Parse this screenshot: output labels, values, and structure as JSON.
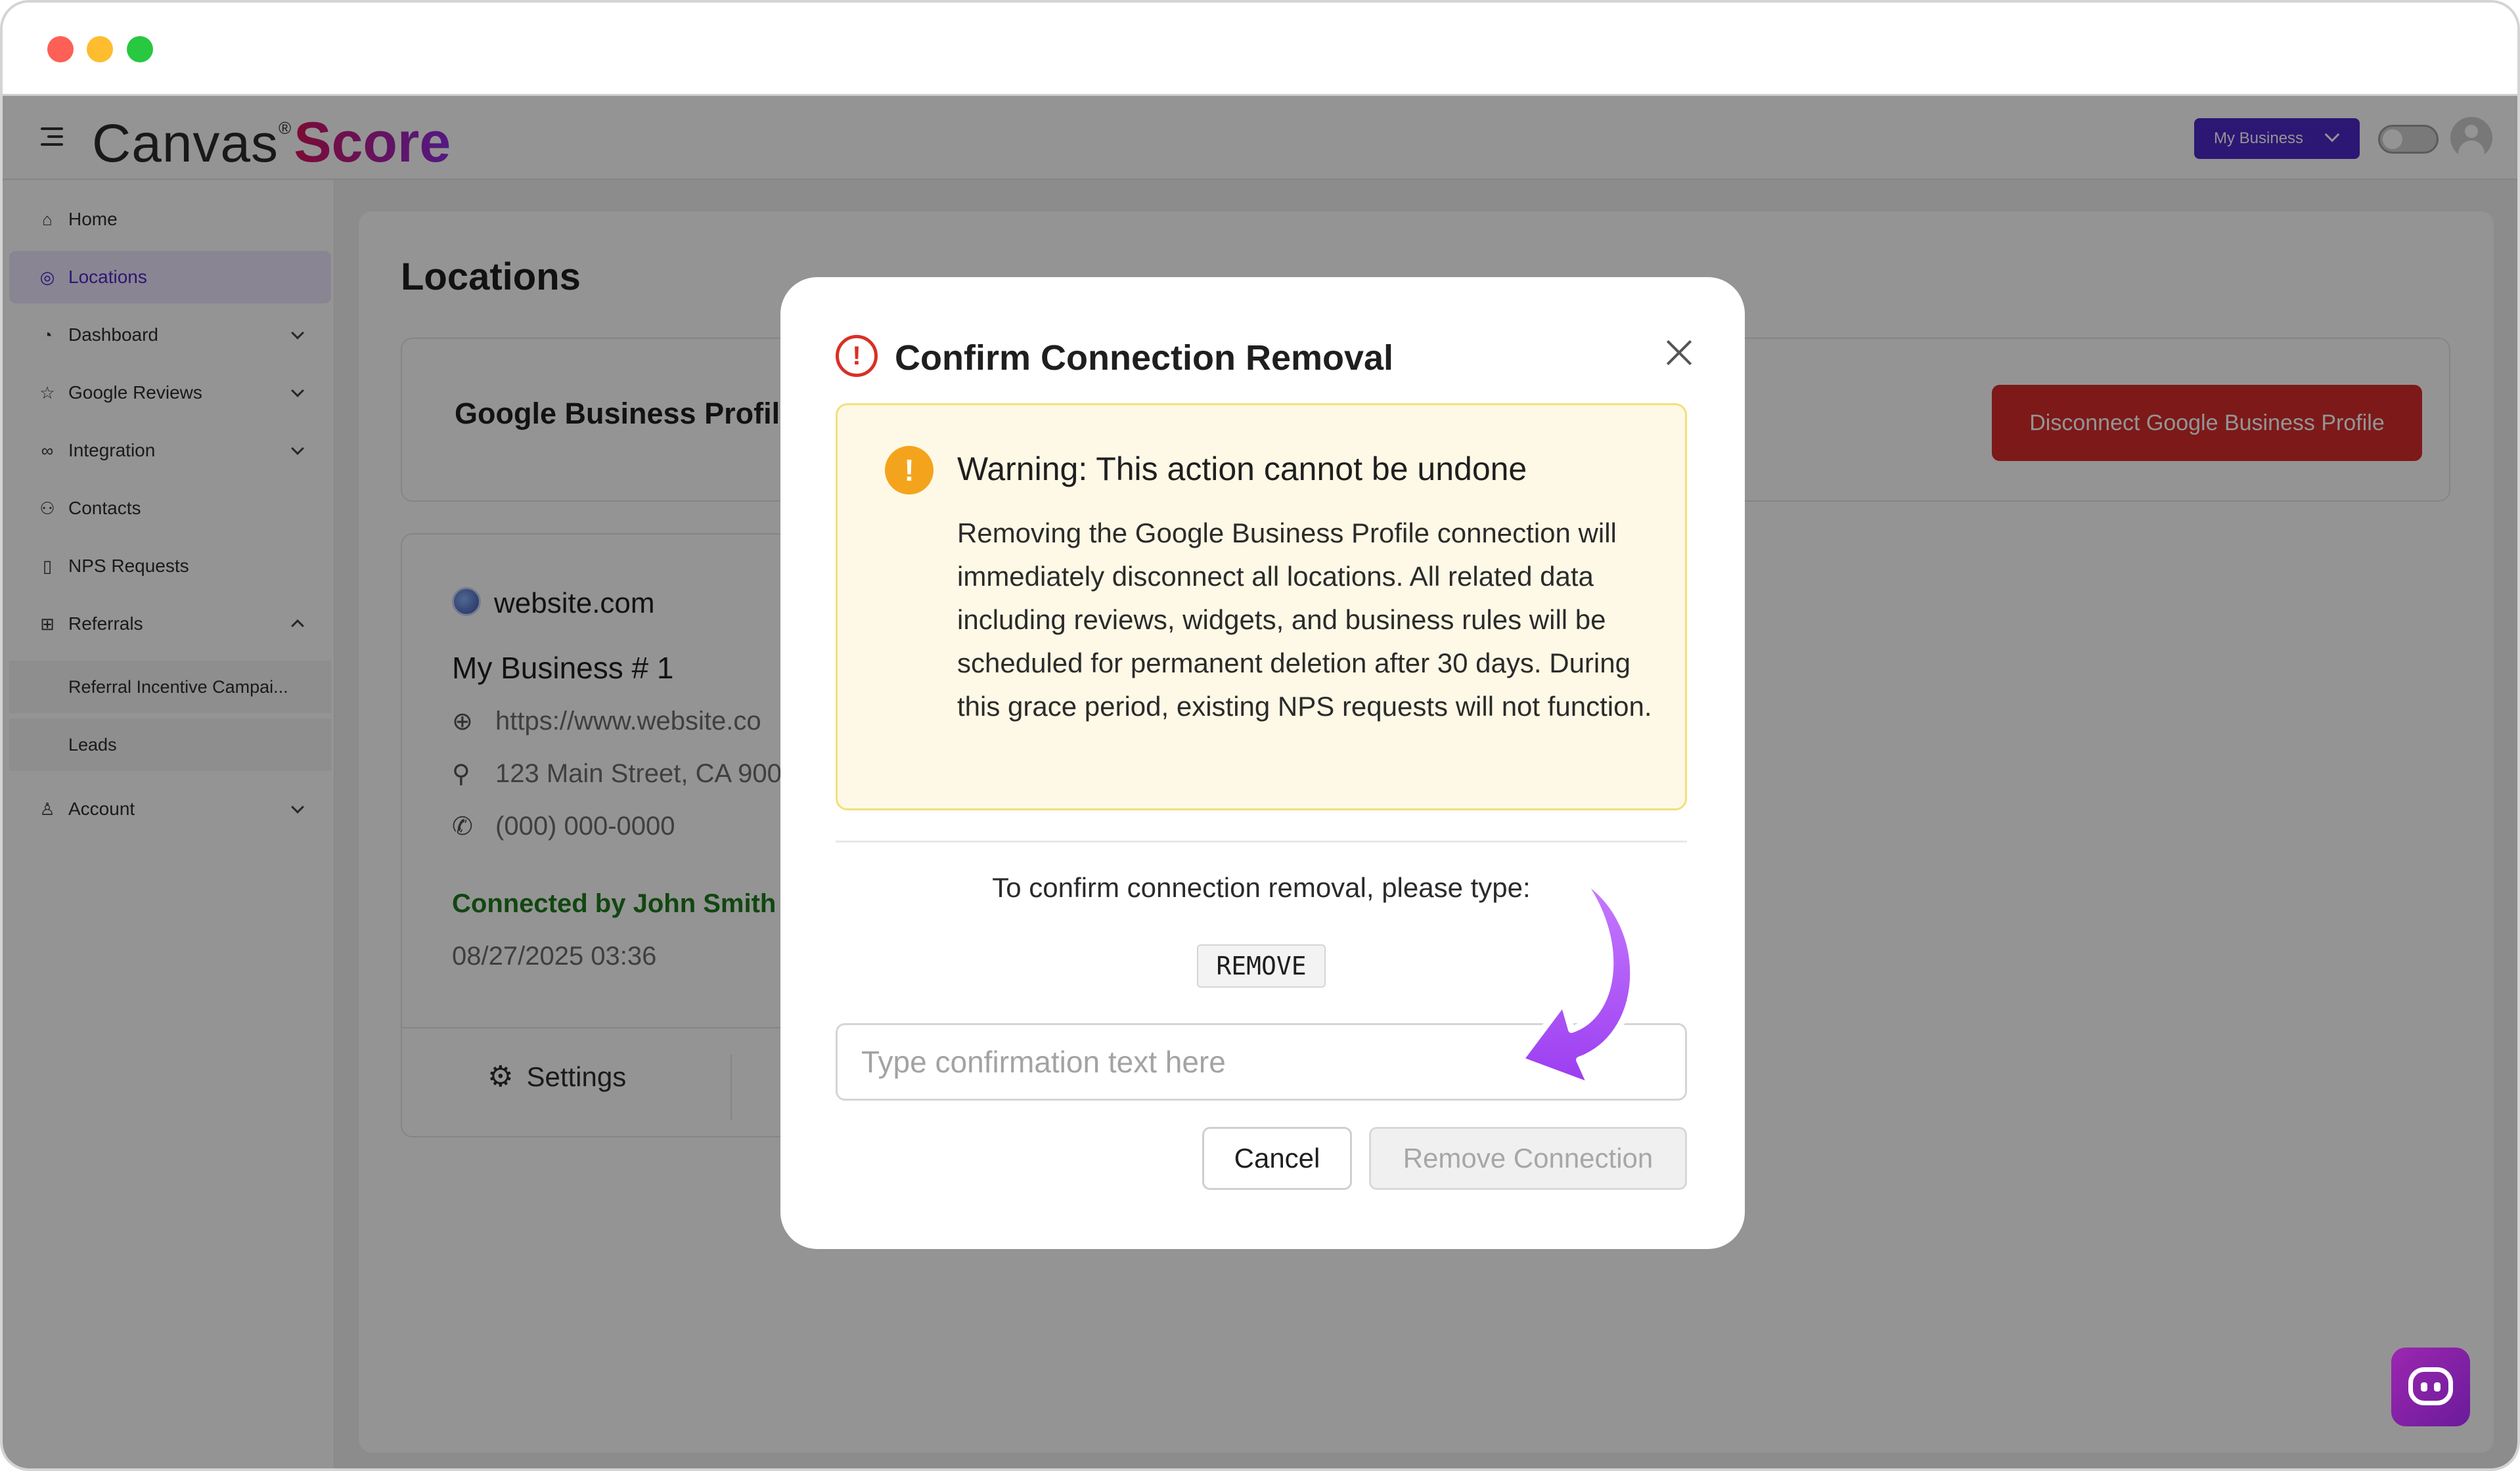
{
  "app": {
    "logo_text": "Canvas",
    "logo_accent": "Score",
    "business_selector": "My Business"
  },
  "sidebar": {
    "items": [
      {
        "label": "Home",
        "icon": "home-icon"
      },
      {
        "label": "Locations",
        "icon": "location-pin-icon",
        "active": true
      },
      {
        "label": "Dashboard",
        "icon": "dashboard-icon",
        "expandable": true
      },
      {
        "label": "Google Reviews",
        "icon": "star-icon",
        "expandable": true
      },
      {
        "label": "Integration",
        "icon": "link-icon",
        "expandable": true
      },
      {
        "label": "Contacts",
        "icon": "contacts-icon"
      },
      {
        "label": "NPS Requests",
        "icon": "document-icon"
      },
      {
        "label": "Referrals",
        "icon": "gift-icon",
        "expanded": true
      },
      {
        "label": "Account",
        "icon": "user-icon",
        "expandable": true
      }
    ],
    "sub_items": [
      {
        "label": "Referral Incentive Campai..."
      },
      {
        "label": "Leads"
      }
    ]
  },
  "page": {
    "title": "Locations",
    "gbp_card_title": "Google Business Profile",
    "disconnect_label": "Disconnect Google Business Profile",
    "location": {
      "domain": "website.com",
      "name": "My Business # 1",
      "url": "https://www.website.co",
      "address": "123 Main Street, CA 900",
      "phone": "(000) 000-0000",
      "connected_by": "Connected by John Smith",
      "connected_date": "08/27/2025 03:36",
      "settings_label": "Settings"
    }
  },
  "modal": {
    "title": "Confirm Connection Removal",
    "warning_title": "Warning: This action cannot be undone",
    "warning_body": "Removing the Google Business Profile connection will immediately disconnect all locations. All related data including reviews, widgets, and business rules will be scheduled for permanent deletion after 30 days. During this grace period, existing NPS requests will not function.",
    "confirm_prompt": "To confirm connection removal, please type:",
    "confirm_code": "REMOVE",
    "input_placeholder": "Type confirmation text here",
    "input_value": "",
    "cancel_label": "Cancel",
    "remove_label": "Remove Connection"
  },
  "colors": {
    "accent": "#4c28c9",
    "danger": "#d72c2c",
    "warning_bg": "#fef9e6",
    "warning_icon": "#f4a41c",
    "connected_green": "#1e7a1e",
    "arrow_purple": "#a855f7"
  }
}
